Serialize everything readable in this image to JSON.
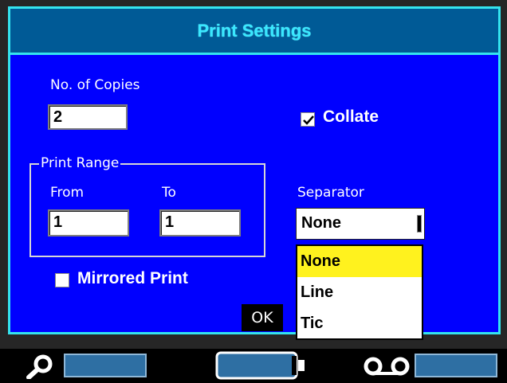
{
  "dialog": {
    "title": "Print Settings"
  },
  "copies": {
    "label": "No. of Copies",
    "value": "2"
  },
  "collate": {
    "label": "Collate",
    "checked": true
  },
  "print_range": {
    "label": "Print Range",
    "from_label": "From",
    "from_value": "1",
    "to_label": "To",
    "to_value": "1"
  },
  "separator": {
    "label": "Separator",
    "value": "None",
    "options": [
      "None",
      "Line",
      "Tic"
    ],
    "selected_index": 0
  },
  "mirrored": {
    "label": "Mirrored Print",
    "checked": false
  },
  "ok_button": {
    "label": "OK"
  },
  "status": {
    "icons": [
      "search-icon",
      "battery-icon",
      "tape-icon"
    ],
    "battery_level": 0.92
  },
  "colors": {
    "dialog_bg": "#0000ff",
    "border": "#34e4ef",
    "title": "#39e8ff",
    "highlight": "#fff21e"
  }
}
